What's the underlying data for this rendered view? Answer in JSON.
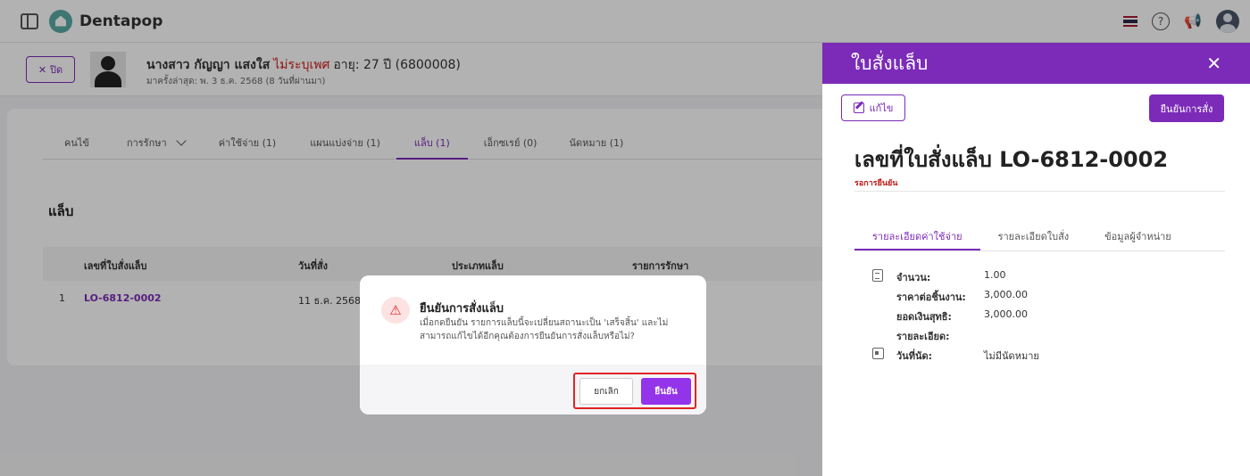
{
  "app": {
    "brand": "Dentapop"
  },
  "patient": {
    "close_label": "ปิด",
    "name": "นางสาว กัญญา แสงใส",
    "gender": "ไม่ระบุเพศ",
    "age": "อายุ: 27 ปี (6800008)",
    "last_visit": "มาครั้งล่าสุด: พ. 3 ธ.ค. 2568 (8 วันที่ผ่านมา)"
  },
  "tabs": [
    {
      "label": "คนไข้"
    },
    {
      "label": "การรักษา"
    },
    {
      "label": "ค่าใช้จ่าย (1)"
    },
    {
      "label": "แผนแบ่งจ่าย (1)"
    },
    {
      "label": "แล็บ (1)",
      "active": true
    },
    {
      "label": "เอ็กซเรย์ (0)"
    },
    {
      "label": "นัดหมาย (1)"
    }
  ],
  "lab_section": {
    "title": "แล็บ",
    "columns": [
      "เลขที่ใบสั่งแล็บ",
      "วันที่สั่ง",
      "ประเภทแล็บ",
      "รายการรักษา"
    ],
    "rows": [
      {
        "index": "1",
        "order_no": "LO-6812-0002",
        "date": "11 ธ.ค. 2568"
      }
    ]
  },
  "panel": {
    "title": "ใบสั่งแล็บ",
    "edit_label": "แก้ไข",
    "confirm_label": "ยืนยันการสั่ง",
    "order_no": "เลขที่ใบสั่งแล็บ LO-6812-0002",
    "status": "รอการยืนยัน",
    "tabs": [
      "รายละเอียดค่าใช้จ่าย",
      "รายละเอียดใบสั่ง",
      "ข้อมูลผู้จำหน่าย"
    ],
    "details": [
      {
        "label": "จำนวน:",
        "value": "1.00"
      },
      {
        "label": "ราคาต่อชิ้นงาน:",
        "value": "3,000.00"
      },
      {
        "label": "ยอดเงินสุทธิ:",
        "value": "3,000.00"
      },
      {
        "label": "รายละเอียด:",
        "value": ""
      },
      {
        "label": "วันที่นัด:",
        "value": "ไม่มีนัดหมาย"
      }
    ]
  },
  "dialog": {
    "title": "ยืนยันการสั่งแล็บ",
    "message": "เมื่อกดยืนยัน รายการแล็บนี้จะเปลี่ยนสถานะเป็น 'เสร็จสิ้น' และไม่สามารถแก้ไขได้อีกคุณต้องการยืนยันการสั่งแล็บหรือไม่?",
    "cancel_label": "ยกเลิก",
    "confirm_label": "ยืนยัน"
  },
  "colors": {
    "accent": "#7b2bb8",
    "danger": "#e02424"
  }
}
